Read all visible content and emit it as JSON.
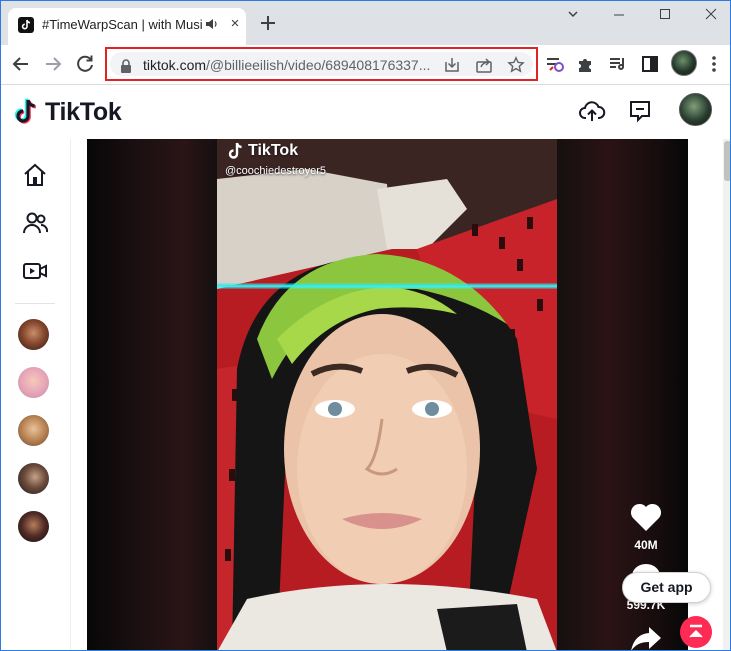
{
  "browser": {
    "tab": {
      "title": "#TimeWarpScan | with Music",
      "audio": "speaker-icon",
      "close": "×"
    },
    "window_controls": [
      "minimize",
      "maximize",
      "close"
    ],
    "address": {
      "domain": "tiktok.com",
      "path": "/@billieeilish/video/689408176337...",
      "highlight_color": "#e02424"
    }
  },
  "tiktok": {
    "logo": "TikTok",
    "accent_colors": {
      "cyan": "#25f4ee",
      "red": "#fe2c55"
    }
  },
  "video": {
    "watermark": "TikTok",
    "username": "@coochiedestroyer5",
    "effect_line_color": "#36f3f7"
  },
  "actions": {
    "likes": "40M",
    "comments": "599.7K"
  },
  "buttons": {
    "get_app": "Get app"
  }
}
